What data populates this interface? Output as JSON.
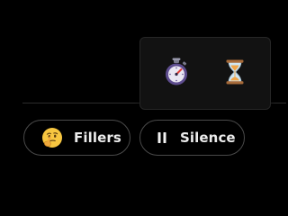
{
  "popup": {
    "items": [
      {
        "icon": "stopwatch-icon"
      },
      {
        "icon": "hourglass-icon"
      }
    ]
  },
  "chips": [
    {
      "label": "Fillers",
      "icon": "thinking-face-icon"
    },
    {
      "label": "Silence",
      "icon": "pause-icon"
    }
  ],
  "colors": {
    "background": "#000000",
    "chip_border": "#4a4a4a",
    "chip_text": "#ececec",
    "popup_bg": "#121212"
  }
}
